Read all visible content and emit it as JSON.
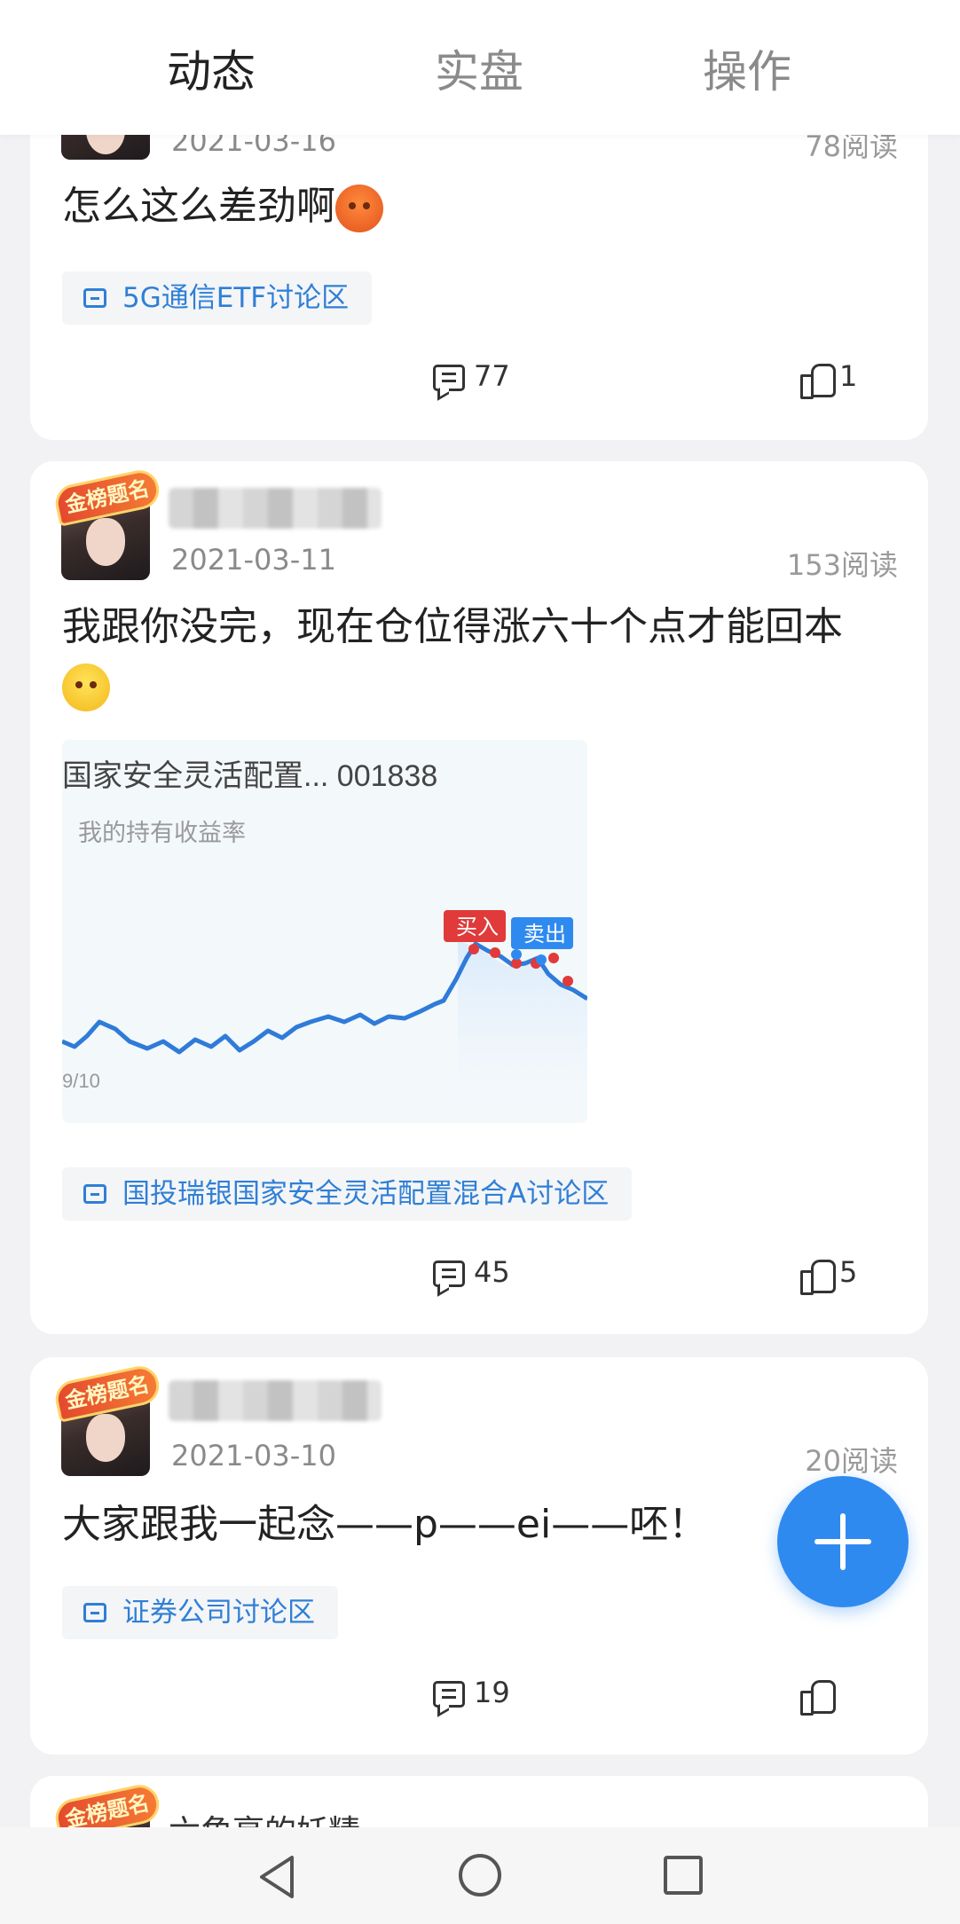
{
  "tabs": [
    {
      "label": "动态",
      "active": true
    },
    {
      "label": "实盘",
      "active": false
    },
    {
      "label": "操作",
      "active": false
    }
  ],
  "posts": [
    {
      "date": "2021-03-16",
      "reads": "78阅读",
      "text": "怎么这么差劲啊",
      "emoji": "angry-crying-face",
      "tag": "5G通信ETF讨论区",
      "comments": "77",
      "likes": "1"
    },
    {
      "badge": "金榜题名",
      "date": "2021-03-11",
      "reads": "153阅读",
      "text": "我跟你没完，现在仓位得涨六十个点才能回本",
      "emoji": "crying-face",
      "image": {
        "title": "国家安全灵活配置... 001838",
        "subtitle": "我的持有收益率",
        "xlabel_start": "9/10",
        "buy_label": "买入",
        "sell_label": "卖出"
      },
      "tag": "国投瑞银国家安全灵活配置混合A讨论区",
      "comments": "45",
      "likes": "5"
    },
    {
      "badge": "金榜题名",
      "date": "2021-03-10",
      "reads": "20阅读",
      "text": "大家跟我一起念——p——ei——呸！",
      "tag": "证券公司讨论区",
      "comments": "19",
      "likes": ""
    },
    {
      "badge": "金榜题名",
      "name": "六角亭的妖精"
    }
  ],
  "colors": {
    "accent": "#2f8af0",
    "tag_text": "#2f7fd6",
    "buy": "#e03a3a",
    "sell": "#2f8af0"
  }
}
